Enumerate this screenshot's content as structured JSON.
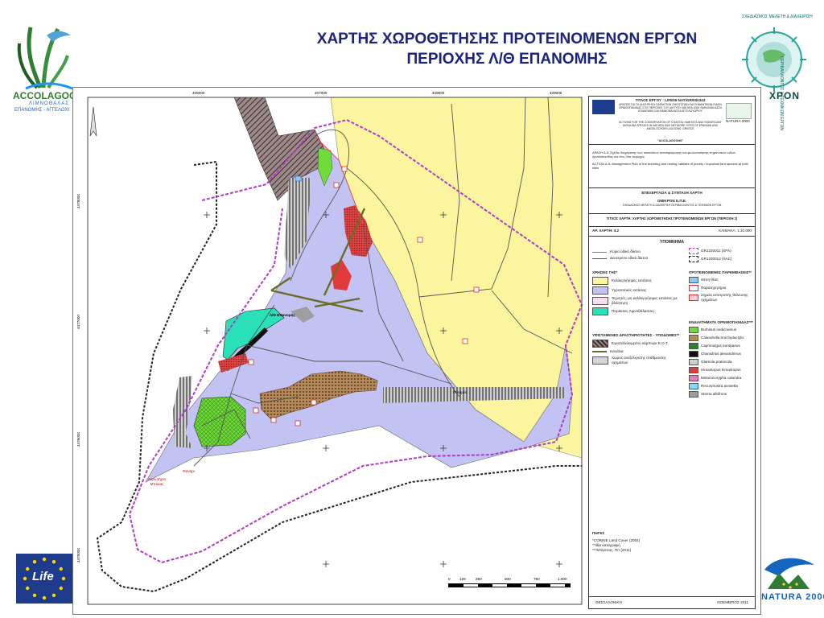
{
  "slide": {
    "title_line1": "ΧΑΡΤΗΣ ΧΩΡΟΘΕΤΗΣΗΣ ΠΡΟΤΕΙΝΟΜΕΝΩΝ ΕΡΓΩΝ",
    "title_line2": "ΠΕΡΙΟΧΗΣ Λ/Θ ΕΠΑΝΟΜΗΣ"
  },
  "logos": {
    "top_left_name": "ACCOLAGOO",
    "top_left_sub": "ΛΙΜΝΟΘΑΛΑΣ",
    "top_left_place": "ΕΠΑΝΟΜΗΣ - ΑΓΓΕΛΟΧΙ",
    "top_right_arc": "ΣΧΕΔΙΑΣΜΟΣ ΜΕΛΕΤΗ & ΔΙΑΧΕΙΡΙΣΗ",
    "top_right_side": "ΠΕΡΙΒΑΛΛΟΝΤΟΣ & ΤΕΧΝΙΚΩΝ ΕΡΓΩΝ",
    "top_right_brand": "ΧΡΟΝ",
    "bottom_left": "Life",
    "bottom_right": "NATURA 2000"
  },
  "map": {
    "grid_labels_top": [
      "405000",
      "407000",
      "409000",
      "409000"
    ],
    "grid_labels_left": [
      "4478000",
      "4477000",
      "4476000",
      "4475000"
    ],
    "place_labels": {
      "lagoon": "Λ/Θ Επανομής",
      "potamos": "Ποταμός",
      "fanari": "Φανάρι",
      "cape": "Ακρωτήριο Μπόκας"
    },
    "scale_labels": [
      "0",
      "125",
      "250",
      "500",
      "750",
      "1.000"
    ]
  },
  "legend": {
    "project_title": "ΤΙΤΛΟΣ ΕΡΓΟΥ : LIFE09 NAT/GR/000343",
    "project_desc_gr": "ΔΡΑΣΕΙΣ ΓΙΑ ΤΗ ΔΙΑΤΗΡΗΣΗ ΠΑΡΑΚΤΙΩΝ ΟΙΚΟΤΟΠΩΝ ΚΑΙ ΣΗΜΑΝΤΙΚΩΝ ΕΙΔΩΝ ΟΡΝΙΘΟΠΑΝΙΔΑΣ ΣΤΙΣ ΠΕΡΙΟΧΕΣ ΤΟΥ ΔΙΚΤΥΟΥ NATURA 2000 ΛΙΜΝΟΘΑΛΑΣΣΑ ΕΠΑΝΟΜΗΣ ΚΑΙ ΛΙΜΝΟΘΑΛΑΣΣΑ ΑΓΓΕΛΟΧΩΡΙΟΥ",
    "project_desc_en": "ACTIONS FOR THE CONSERVATION OF COASTAL HABITATS AND SIGNIFICANT AVIFAUNA SPECIES IN NATURA 2000 NETWORK SITES OF EPANOMI AND ANGELOCHORI LAGOONS, GREECE",
    "project_acronym": "\"ACCOLAGOONS\"",
    "natura_label": "NATURA 2000",
    "action_gr": "ΔΡΑΣΗ Α.5: Σχέδιο διαχείρισης των οικοτόπων αναπαραγωγής και φωλεοποίησης σημαντικών ειδών ορνιθοπανίδας και στις δύο περιοχές",
    "action_en": "ACTION A.5: Management Plan of the breeding and resting habitats of priority / important bird species at both sites",
    "processing_title": "ΕΠΕΞΕΡΓΑΣΙΑ & ΣΥΝΤΑΞΗ ΧΑΡΤΗ",
    "company": "ΟΜΙΚΡΟΝ Ε.Π.Ε.",
    "company_sub": "ΣΧΕΔΙΑΣΜΟΣ ΜΕΛΕΤΗ & ΔΙΑΧΕΙΡΙΣΗ ΠΕΡΙΒΑΛΛΟΝΤΟΣ & ΤΕΧΝΙΚΩΝ ΕΡΓΩΝ",
    "map_title": "ΤΙΤΛΟΣ ΧΑΡΤΗ: ΧΑΡΤΗΣ ΧΩΡΟΘΕΤΗΣΗΣ ΠΡΟΤΕΙΝΟΜΕΝΩΝ ΕΡΓΩΝ (ΠΕΡΙΟΧΗ 2)",
    "map_number": "ΑΡ. ΧΑΡΤΗ: 4.2",
    "scale": "ΚΛΙΜΑΚΑ: 1:10.000",
    "legend_heading": "ΥΠΟΜΝΗΜΑ",
    "road_main": "Κύριο οδικό δίκτυο",
    "road_secondary": "Δευτερεον οδικό δίκτυο",
    "gr_spa": "GR1220011 (SPA)",
    "gr_sac": "GR1220012 (SAC)",
    "landuse_heading": "ΧΡΗΣΕΙΣ ΓΗΣ*",
    "landuse_items": [
      "Καλλιεργήσιμες εκτάσεις",
      "Υγροτοπικές εκτάσεις",
      "Τεχνητές, μη καλλιεργήσιμες εκτάσεις με βλάστηση",
      "Παράκτιες Λιμνοθάλασσες"
    ],
    "proposed_heading": "ΠΡΟΤΕΙΝΟΜΕΝΕΣ ΠΑΡΕΜΒΑΣΕΙΣ**",
    "proposed_items": [
      "Θέση θέας",
      "Παρατηρητήριο",
      "Σημεία αποτροπής θέλευσης οχημάτων"
    ],
    "existing_heading": "ΥΦΙΣΤΑΜΕΝΕΣ ΔΡΑΣΤΗΡΙΟΤΗΤΕΣ - ΥΠΟΔΟΜΕΣ**",
    "existing_items": [
      "Εγκαταλελειμμένο κάμπινγκ Ε.Ο.Τ.",
      "Κανάλια",
      "Χώρος ανεξέλεγκτης στάθμευσης οχημάτων"
    ],
    "habitat_heading": "ΕΝΔΙΑΙΤΗΜΑΤΑ ΟΡΝΙΘΟΠΑΝΙΔΑΣ***",
    "habitat_items": [
      "Burhinus oedicnemus",
      "Calandrella brachydactyla",
      "Caprimulgus europaeus",
      "Charadrius alexandrinus",
      "Glareola pratincola",
      "Himantopus himantopus",
      "Melanocorypha calandra",
      "Recurvirostra avosetta",
      "Sterna albifrons"
    ],
    "sources_heading": "ΠΗΓΕΣ",
    "sources": [
      "*CORINE Land Cover (2004)",
      "**Ιδία καταγραφή",
      "***Μπίρτσας, Πιτ (2011)"
    ],
    "footer_place": "ΘΕΣΣΑΛΟΝΙΚΗ",
    "footer_date": "ΝΟΕΜΒΡΙΟΣ 2011"
  },
  "colors": {
    "title": "#1a237e",
    "sea": "#ffffff",
    "wetland": "#c3c3f3",
    "cultivated": "#fbf5a0",
    "lagoon": "#2ae0b8",
    "spa_boundary": "#b03ac8",
    "sac_boundary": "#222222",
    "burhinus": "#6fdc3a",
    "calandrella": "#b58a5a",
    "himantopus": "#e03a3a",
    "melanocorypha": "#e87ab8",
    "recurvirostra": "#7fd8ff"
  }
}
